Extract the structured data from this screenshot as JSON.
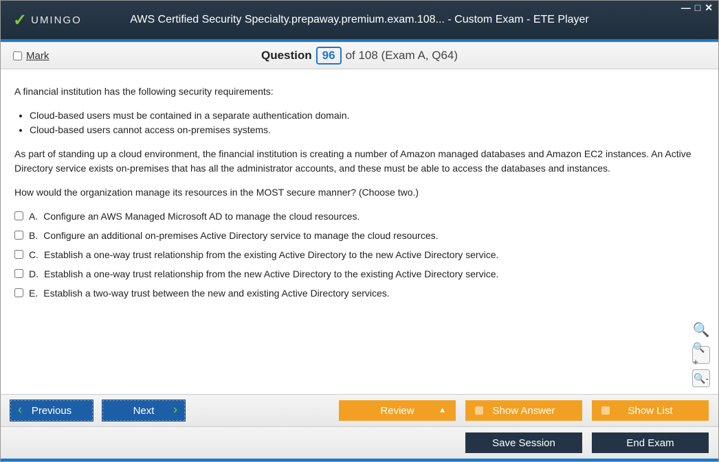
{
  "window": {
    "brand": "UMINGO",
    "title": "AWS Certified Security Specialty.prepaway.premium.exam.108... - Custom Exam - ETE Player"
  },
  "header": {
    "mark_label": "Mark",
    "question_word": "Question",
    "current_number": "96",
    "total_suffix": "of 108 (Exam A, Q64)"
  },
  "question": {
    "intro": "A financial institution has the following security requirements:",
    "bullets": [
      "Cloud-based users must be contained in a separate authentication domain.",
      "Cloud-based users cannot access on-premises systems."
    ],
    "para2": "As part of standing up a cloud environment, the financial institution is creating a number of Amazon managed databases and Amazon EC2 instances. An Active Directory service exists on-premises that has all the administrator accounts, and these must be able to access the databases and instances.",
    "para3": "How would the organization manage its resources in the MOST secure manner? (Choose two.)",
    "choices": [
      {
        "letter": "A.",
        "text": "Configure an AWS Managed Microsoft AD to manage the cloud resources."
      },
      {
        "letter": "B.",
        "text": "Configure an additional on-premises Active Directory service to manage the cloud resources."
      },
      {
        "letter": "C.",
        "text": "Establish a one-way trust relationship from the existing Active Directory to the new Active Directory service."
      },
      {
        "letter": "D.",
        "text": "Establish a one-way trust relationship from the new Active Directory to the existing Active Directory service."
      },
      {
        "letter": "E.",
        "text": "Establish a two-way trust between the new and existing Active Directory services."
      }
    ]
  },
  "buttons": {
    "previous": "Previous",
    "next": "Next",
    "review": "Review",
    "show_answer": "Show Answer",
    "show_list": "Show List",
    "save_session": "Save Session",
    "end_exam": "End Exam"
  }
}
